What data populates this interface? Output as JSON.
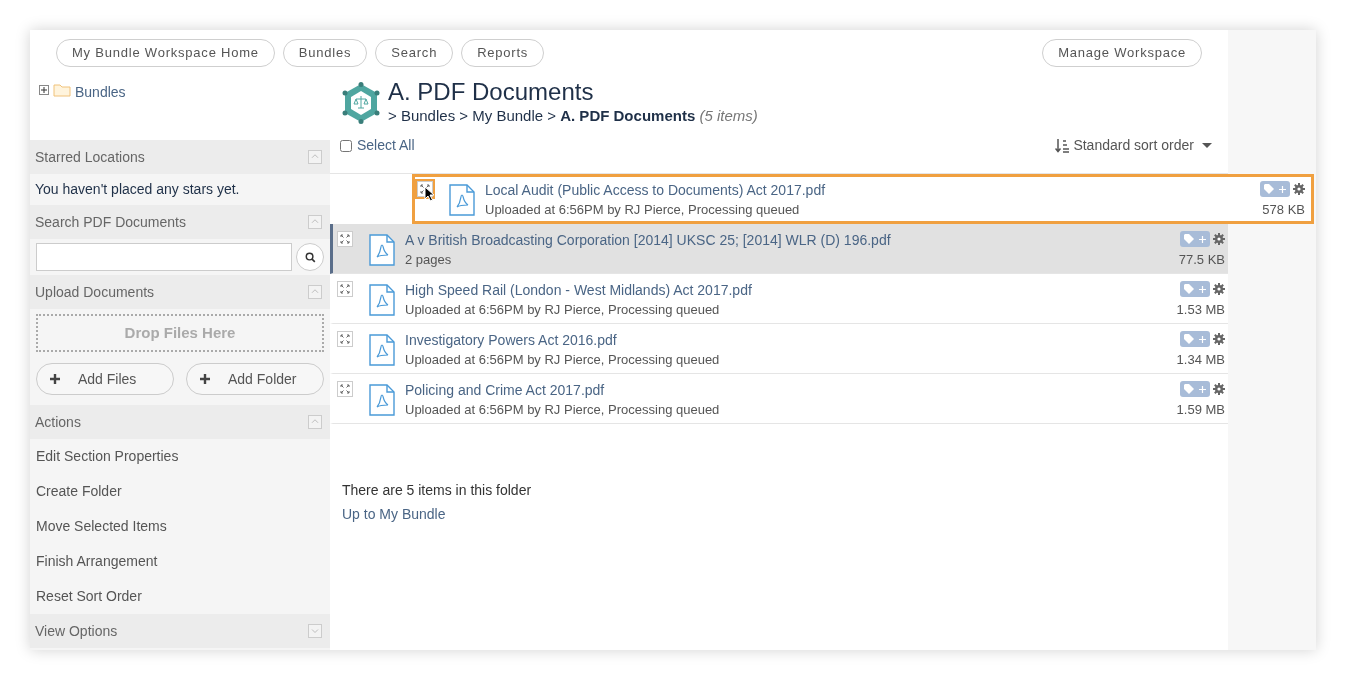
{
  "nav": {
    "buttons": [
      "My Bundle Workspace Home",
      "Bundles",
      "Search",
      "Reports"
    ],
    "right_button": "Manage Workspace"
  },
  "tree": {
    "label": "Bundles",
    "expanded": false
  },
  "sidebar": [
    {
      "kind": "message",
      "title": "Starred Locations",
      "expanded": true,
      "text": "You haven't placed any stars yet."
    },
    {
      "kind": "search",
      "title": "Search PDF Documents",
      "expanded": true
    },
    {
      "kind": "upload",
      "title": "Upload Documents",
      "expanded": true,
      "drop": "Drop Files Here",
      "buttons": [
        "Add Files",
        "Add Folder"
      ]
    },
    {
      "kind": "actions",
      "title": "Actions",
      "expanded": true,
      "items": [
        "Edit Section Properties",
        "Create Folder",
        "Move Selected Items",
        "Finish Arrangement",
        "Reset Sort Order"
      ]
    },
    {
      "title": "View Options",
      "expanded": false
    }
  ],
  "header": {
    "title": "A. PDF Documents",
    "breadcrumb": [
      "> Bundles",
      "> My Bundle"
    ],
    "current": "> **A. PDF Documents**",
    "count": "(5 items)"
  },
  "select_all": {
    "label": "Select All",
    "checked": false
  },
  "sort": {
    "label": "Standard sort order"
  },
  "dragging": {
    "name": "Local Audit (Public Access to Documents) Act 2017.pdf",
    "meta": "Uploaded at 6:56PM by RJ Pierce, Processing queued",
    "size": "578 KB"
  },
  "rows": [
    {
      "name": "A v British Broadcasting Corporation [2014] UKSC 25;  [2014] WLR (D)  196.pdf",
      "meta": "2 pages",
      "size": "77.5 KB",
      "selected": true
    },
    {
      "name": "High Speed Rail (London - West Midlands) Act 2017.pdf",
      "meta": "Uploaded at 6:56PM by RJ Pierce, Processing queued",
      "size": "1.53 MB",
      "selected": false
    },
    {
      "name": "Investigatory Powers Act 2016.pdf",
      "meta": "Uploaded at 6:56PM by RJ Pierce, Processing queued",
      "size": "1.34 MB",
      "selected": false
    },
    {
      "name": "Policing and Crime Act 2017.pdf",
      "meta": "Uploaded at 6:56PM by RJ Pierce, Processing queued",
      "size": "1.59 MB",
      "selected": false
    }
  ],
  "footer": {
    "text": "There are 5 items in this folder",
    "link": "Up to My Bundle"
  }
}
